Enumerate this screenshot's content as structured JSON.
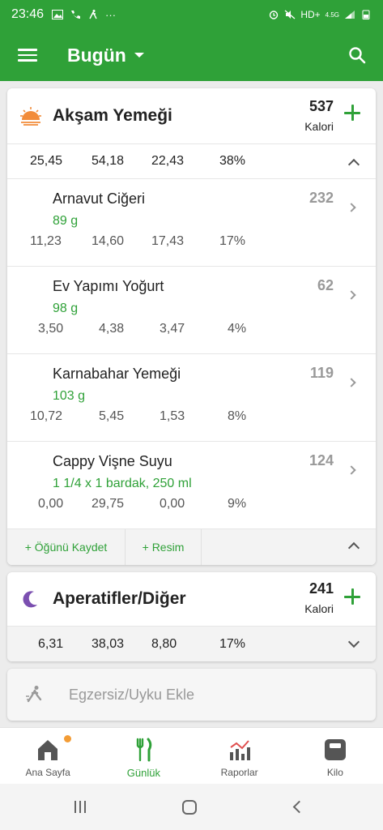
{
  "status_bar": {
    "time": "23:46",
    "network": "HD+",
    "network_type": "4.5G",
    "more": "···"
  },
  "app_bar": {
    "title": "Bugün",
    "menu_icon": "hamburger-icon",
    "search_icon": "search-icon"
  },
  "meals": [
    {
      "name": "Akşam Yemeği",
      "icon": "sunset-icon",
      "calories": "537",
      "calorie_unit": "Kalori",
      "totals": [
        "25,45",
        "54,18",
        "22,43",
        "38%"
      ],
      "items": [
        {
          "name": "Arnavut Ciğeri",
          "quantity": "89  g",
          "calories": "232",
          "macros": [
            "11,23",
            "14,60",
            "17,43",
            "17%"
          ]
        },
        {
          "name": "Ev Yapımı Yoğurt",
          "quantity": "98  g",
          "calories": "62",
          "macros": [
            "3,50",
            "4,38",
            "3,47",
            "4%"
          ]
        },
        {
          "name": "Karnabahar Yemeği",
          "quantity": "103  g",
          "calories": "119",
          "macros": [
            "10,72",
            "5,45",
            "1,53",
            "8%"
          ]
        },
        {
          "name": "Cappy Vişne Suyu",
          "quantity": "1 1/4 x 1 bardak, 250 ml",
          "calories": "124",
          "macros": [
            "0,00",
            "29,75",
            "0,00",
            "9%"
          ]
        }
      ],
      "actions": {
        "save_meal": "+ Öğünü Kaydet",
        "photo": "+ Resim"
      }
    },
    {
      "name": "Aperatifler/Diğer",
      "icon": "moon-icon",
      "calories": "241",
      "calorie_unit": "Kalori",
      "totals": [
        "6,31",
        "38,03",
        "8,80",
        "17%"
      ]
    }
  ],
  "exercise": {
    "label": "Egzersiz/Uyku Ekle"
  },
  "bottom_nav": {
    "tabs": [
      {
        "label": "Ana Sayfa",
        "icon": "home-icon"
      },
      {
        "label": "Günlük",
        "icon": "cutlery-icon",
        "active": true
      },
      {
        "label": "Raporlar",
        "icon": "chart-icon"
      },
      {
        "label": "Kilo",
        "icon": "scale-icon"
      }
    ]
  },
  "colors": {
    "primary": "#2fa138",
    "badge": "#f39c35",
    "moon": "#7b4fb0",
    "sun": "#f28c3a"
  }
}
